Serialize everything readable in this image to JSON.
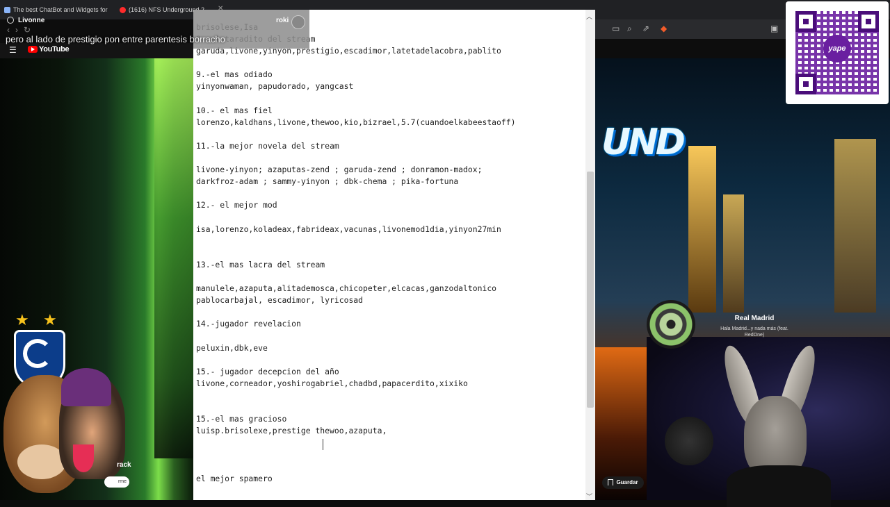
{
  "browser": {
    "tabs": [
      {
        "label": "The best ChatBot and Widgets for K"
      },
      {
        "label": "(1616) NFS Underground 2"
      }
    ],
    "viewer_name": "Livonne",
    "youtube_label": "YouTube"
  },
  "chat_overlay": {
    "message": "pero al lado de prestigio pon entre parentesis borracho"
  },
  "toast": {
    "username": "roki"
  },
  "document": {
    "lines": [
      "brisolese,Isa",
      "8.-el taradito del stream",
      "garuda,livone,yinyon,prestigio,escadimor,latetadelacobra,pablito",
      "",
      "9.-el mas odiado",
      "yinyonwaman, papudorado, yangcast",
      "",
      "10.- el mas fiel",
      "lorenzo,kaldhans,livone,thewoo,kio,bizrael,5.7(cuandoelkabeestaoff)",
      "",
      "11.-la mejor novela del stream",
      "",
      "livone-yinyon; azaputas-zend ; garuda-zend ; donramon-madox;",
      "darkfroz-adam ; sammy-yinyon ; dbk-chema ; pika-fortuna",
      "",
      "12.- el mejor mod",
      "",
      "isa,lorenzo,koladeax,fabrideax,vacunas,livonemod1dia,yinyon27min",
      "",
      "",
      "13.-el mas lacra del stream",
      "",
      "manulele,azaputa,alitademosca,chicopeter,elcacas,ganzodaltonico",
      "pablocarbajal, escadimor, lyricosad",
      "",
      "14.-jugador revelacion",
      "",
      "peluxin,dbk,eve",
      "",
      "15.- jugador decepcion del año",
      "livone,corneador,yoshirogabriel,chadbd,papacerdito,xixiko",
      "",
      "",
      "15.-el mas gracioso",
      "luisp.brisolexe,prestige thewoo,azaputa,",
      "",
      "",
      "",
      "el mejor spamero"
    ]
  },
  "music_widget": {
    "title": "Real Madrid",
    "artist": "Hala Madrid...y nada más (feat. RedOne)"
  },
  "qr": {
    "brand": "yape",
    "accent_color": "#6a1fa0"
  },
  "left_widget": {
    "track_label": "rack",
    "confirm_label": "rme"
  },
  "save_button": {
    "label": "Guardar"
  }
}
